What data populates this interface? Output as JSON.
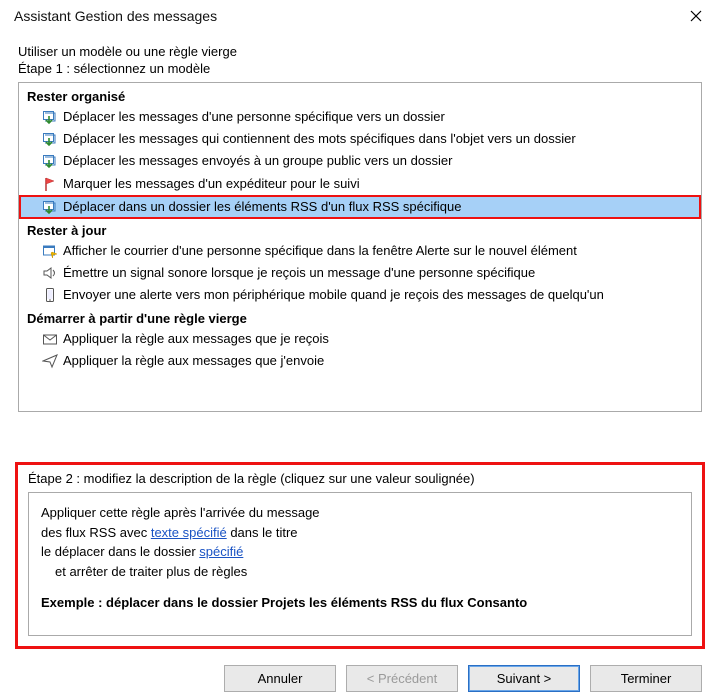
{
  "title": "Assistant Gestion des messages",
  "labels": {
    "use_template": "Utiliser un modèle ou une règle vierge",
    "step1": "Étape 1 : sélectionnez un modèle",
    "step2": "Étape 2 : modifiez la description de la règle (cliquez sur une valeur soulignée)"
  },
  "groups": {
    "g1": "Rester organisé",
    "g2": "Rester à jour",
    "g3": "Démarrer à partir d'une règle vierge"
  },
  "rules": {
    "r1": "Déplacer les messages d'une personne spécifique vers un dossier",
    "r2": "Déplacer les messages qui contiennent des mots spécifiques dans l'objet vers un dossier",
    "r3": "Déplacer les messages envoyés à un groupe public vers un dossier",
    "r4": "Marquer les messages d'un expéditeur pour le suivi",
    "r5": "Déplacer dans un dossier les éléments RSS d'un flux RSS spécifique",
    "r6": "Afficher le courrier d'une personne spécifique dans la fenêtre Alerte sur le nouvel élément",
    "r7": "Émettre un signal sonore lorsque je reçois un message d'une personne spécifique",
    "r8": "Envoyer une alerte vers mon périphérique mobile quand je reçois des messages de quelqu'un",
    "r9": "Appliquer la règle aux messages que je reçois",
    "r10": "Appliquer la règle aux messages que j'envoie"
  },
  "desc": {
    "l1": "Appliquer cette règle après l'arrivée du message",
    "l2a": "des flux RSS avec ",
    "l2link": "texte spécifié",
    "l2b": " dans le titre",
    "l3a": "le déplacer dans le dossier ",
    "l3link": "spécifié",
    "l4": "et arrêter de traiter plus de règles",
    "example": "Exemple : déplacer dans le dossier Projets les éléments RSS du flux Consanto"
  },
  "buttons": {
    "cancel": "Annuler",
    "prev": "< Précédent",
    "next": "Suivant >",
    "finish": "Terminer"
  }
}
